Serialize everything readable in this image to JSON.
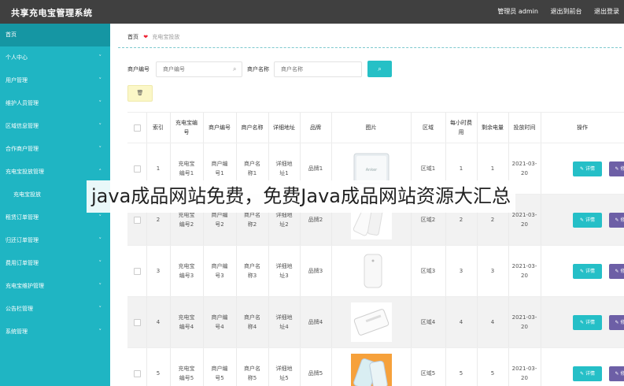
{
  "app": {
    "title": "共享充电宝管理系统"
  },
  "topnav": {
    "admin": "管理员 admin",
    "front": "退出到前台",
    "logout": "退出登录"
  },
  "sidebar": {
    "items": [
      {
        "label": "首页",
        "chevron": "",
        "active": true
      },
      {
        "label": "个人中心",
        "chevron": "˅"
      },
      {
        "label": "用户管理",
        "chevron": "˅"
      },
      {
        "label": "维护人员管理",
        "chevron": "˅"
      },
      {
        "label": "区域信息管理",
        "chevron": "˅"
      },
      {
        "label": "合作商户管理",
        "chevron": "˅"
      },
      {
        "label": "充电宝投放管理",
        "chevron": "˄"
      },
      {
        "label": "充电宝投放",
        "chevron": "",
        "sub": true
      },
      {
        "label": "租赁订单管理",
        "chevron": "˅"
      },
      {
        "label": "归还订单管理",
        "chevron": "˅"
      },
      {
        "label": "费用订单管理",
        "chevron": "˅"
      },
      {
        "label": "充电宝维护管理",
        "chevron": "˅"
      },
      {
        "label": "公告栏管理",
        "chevron": "˅"
      },
      {
        "label": "系统管理",
        "chevron": "˅"
      }
    ]
  },
  "breadcrumb": {
    "home": "首页",
    "icon": "❤",
    "current": "充电宝投放"
  },
  "search": {
    "merchant_no_label": "商户编号",
    "merchant_no_placeholder": "商户编号",
    "merchant_name_label": "商户名称",
    "merchant_name_placeholder": "商户名称",
    "search_icon": "⌕",
    "button_icon": "⌕"
  },
  "toolbar": {
    "delete_icon": "🗑"
  },
  "table": {
    "headers": [
      "索引",
      "充电宝编号",
      "商户编号",
      "商户名称",
      "详细地址",
      "品牌",
      "图片",
      "区域",
      "每小时费用",
      "剩余电量",
      "投放时间",
      "操作"
    ],
    "detail_label": "✎ 详情",
    "edit_label": "✎ 修改",
    "rows": [
      {
        "index": "1",
        "code": "充电宝编号1",
        "merchant_no": "商户编号1",
        "merchant_name": "商户名称1",
        "address": "详细地址1",
        "brand": "品牌1",
        "region": "区域1",
        "fee": "1",
        "battery": "1",
        "time": "2021-03-20"
      },
      {
        "index": "2",
        "code": "充电宝编号2",
        "merchant_no": "商户编号2",
        "merchant_name": "商户名称2",
        "address": "详细地址2",
        "brand": "品牌2",
        "region": "区域2",
        "fee": "2",
        "battery": "2",
        "time": "2021-03-20"
      },
      {
        "index": "3",
        "code": "充电宝编号3",
        "merchant_no": "商户编号3",
        "merchant_name": "商户名称3",
        "address": "详细地址3",
        "brand": "品牌3",
        "region": "区域3",
        "fee": "3",
        "battery": "3",
        "time": "2021-03-20"
      },
      {
        "index": "4",
        "code": "充电宝编号4",
        "merchant_no": "商户编号4",
        "merchant_name": "商户名称4",
        "address": "详细地址4",
        "brand": "品牌4",
        "region": "区域4",
        "fee": "4",
        "battery": "4",
        "time": "2021-03-20"
      },
      {
        "index": "5",
        "code": "充电宝编号5",
        "merchant_no": "商户编号5",
        "merchant_name": "商户名称5",
        "address": "详细地址5",
        "brand": "品牌5",
        "region": "区域5",
        "fee": "5",
        "battery": "5",
        "time": "2021-03-20"
      }
    ]
  },
  "overlay_text": "java成品网站免费，免费Java成品网站资源大汇总",
  "colors": {
    "topbar": "#404040",
    "sidebar": "#1fb5c3",
    "detail_button": "#25bfc7",
    "edit_button": "#6d5fa6",
    "search_button": "#26c0c6"
  }
}
